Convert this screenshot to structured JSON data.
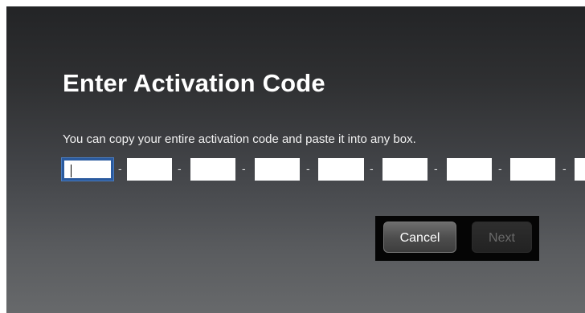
{
  "dialog": {
    "title": "Enter Activation Code",
    "instructions": "You can copy your entire activation code and paste it into any box.",
    "code_fields": [
      {
        "value": "",
        "focused": true
      },
      {
        "value": "",
        "focused": false
      },
      {
        "value": "",
        "focused": false
      },
      {
        "value": "",
        "focused": false
      },
      {
        "value": "",
        "focused": false
      },
      {
        "value": "",
        "focused": false
      },
      {
        "value": "",
        "focused": false
      },
      {
        "value": "",
        "focused": false
      }
    ],
    "separator": "-",
    "buttons": {
      "cancel_label": "Cancel",
      "next_label": "Next",
      "next_enabled": false
    }
  },
  "colors": {
    "focus_border": "#2a5a9e",
    "background_top": "#232426",
    "background_bottom": "#67696b",
    "disabled_text": "#6a6a6a"
  }
}
